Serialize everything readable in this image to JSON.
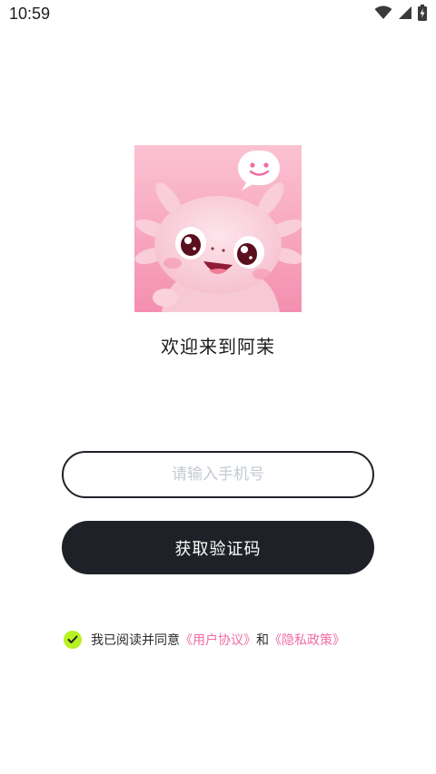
{
  "status_bar": {
    "time": "10:59"
  },
  "app": {
    "logo_icon": "axolotl-mascot-icon",
    "welcome_text": "欢迎来到阿茉"
  },
  "login": {
    "phone_placeholder": "请输入手机号",
    "phone_value": "",
    "get_code_label": "获取验证码"
  },
  "agreement": {
    "checked": true,
    "prefix": "我已阅读并同意",
    "user_agreement": "《用户协议》",
    "and": "和",
    "privacy_policy": "《隐私政策》"
  },
  "colors": {
    "accent_pink": "#f06ca4",
    "check_green": "#b6f21f",
    "button_dark": "#1e2127",
    "logo_bg": "#f7a3bd"
  }
}
